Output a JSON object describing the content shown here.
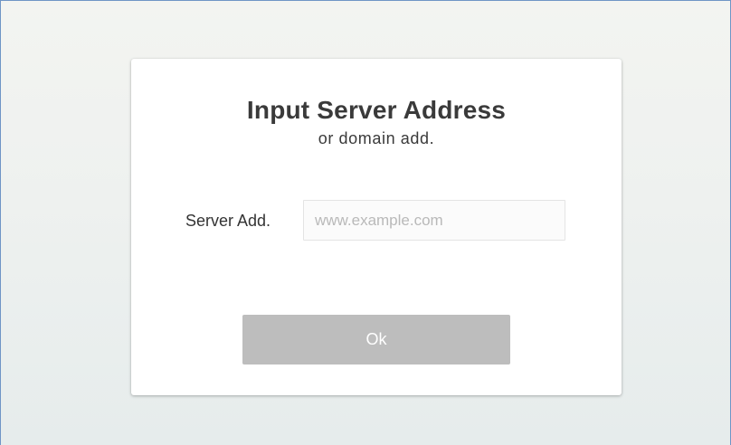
{
  "dialog": {
    "title": "Input Server Address",
    "subtitle": "or domain add."
  },
  "form": {
    "server_label": "Server Add.",
    "server_value": "",
    "server_placeholder": "www.example.com"
  },
  "actions": {
    "ok_label": "Ok"
  },
  "colors": {
    "window_border": "#6f95c6",
    "button_background": "#bdbdbd",
    "button_text": "#ffffff",
    "title_text": "#3a3a3a",
    "placeholder_text": "#b9b9b9"
  }
}
